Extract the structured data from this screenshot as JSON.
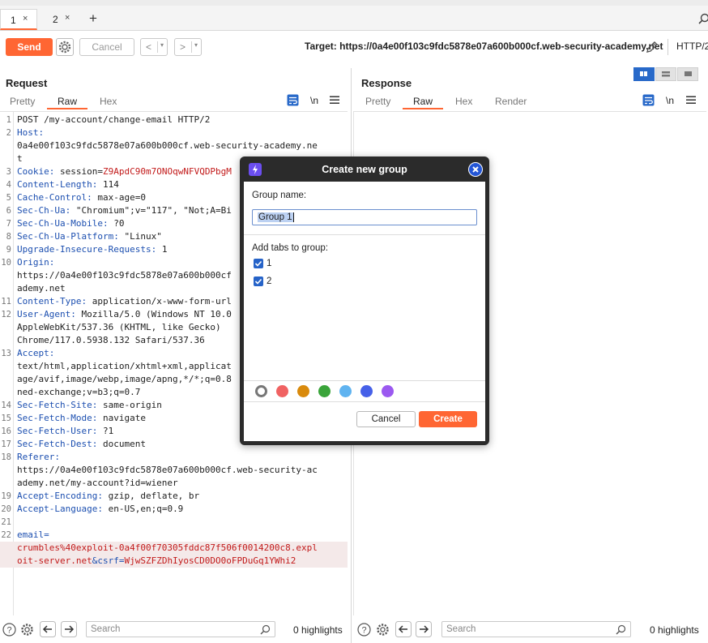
{
  "tabs": [
    {
      "label": "1",
      "close": "×"
    },
    {
      "label": "2",
      "close": "×"
    }
  ],
  "new_tab_icon": "+",
  "toolbar": {
    "send_label": "Send",
    "cancel_label": "Cancel",
    "back_arrow": "<",
    "fwd_arrow": ">",
    "dropdown_caret": "▾",
    "target": "Target: https://0a4e00f103c9fdc5878e07a600b000cf.web-security-academy.net",
    "protocol": "HTTP/2"
  },
  "request": {
    "title": "Request",
    "tabs": [
      "Pretty",
      "Raw",
      "Hex"
    ],
    "active_tab": "Raw",
    "newline_toggle": "\\n",
    "lines": [
      {
        "n": "1",
        "text": "POST /my-account/change-email HTTP/2"
      },
      {
        "n": "2",
        "key": "Host",
        "val": ""
      },
      {
        "n": "",
        "text": "0a4e00f103c9fdc5878e07a600b000cf.web-security-academy.ne"
      },
      {
        "n": "",
        "text": "t"
      },
      {
        "n": "3",
        "key": "Cookie",
        "val": "session=",
        "red": "Z9ApdC90m7ONOqwNFVQDPbgM"
      },
      {
        "n": "4",
        "key": "Content-Length",
        "val": "114"
      },
      {
        "n": "5",
        "key": "Cache-Control",
        "val": "max-age=0"
      },
      {
        "n": "6",
        "key": "Sec-Ch-Ua",
        "val": "\"Chromium\";v=\"117\", \"Not;A=Bi"
      },
      {
        "n": "7",
        "key": "Sec-Ch-Ua-Mobile",
        "val": "?0"
      },
      {
        "n": "8",
        "key": "Sec-Ch-Ua-Platform",
        "val": "\"Linux\""
      },
      {
        "n": "9",
        "key": "Upgrade-Insecure-Requests",
        "val": "1"
      },
      {
        "n": "10",
        "key": "Origin",
        "val": ""
      },
      {
        "n": "",
        "text": "https://0a4e00f103c9fdc5878e07a600b000cf"
      },
      {
        "n": "",
        "text": "ademy.net"
      },
      {
        "n": "11",
        "key": "Content-Type",
        "val": "application/x-www-form-url"
      },
      {
        "n": "12",
        "key": "User-Agent",
        "val": "Mozilla/5.0 (Windows NT 10.0"
      },
      {
        "n": "",
        "text": "AppleWebKit/537.36 (KHTML, like Gecko)"
      },
      {
        "n": "",
        "text": "Chrome/117.0.5938.132 Safari/537.36"
      },
      {
        "n": "13",
        "key": "Accept",
        "val": ""
      },
      {
        "n": "",
        "text": "text/html,application/xhtml+xml,applicat"
      },
      {
        "n": "",
        "text": "age/avif,image/webp,image/apng,*/*;q=0.8"
      },
      {
        "n": "",
        "text": "ned-exchange;v=b3;q=0.7"
      },
      {
        "n": "14",
        "key": "Sec-Fetch-Site",
        "val": "same-origin"
      },
      {
        "n": "15",
        "key": "Sec-Fetch-Mode",
        "val": "navigate"
      },
      {
        "n": "16",
        "key": "Sec-Fetch-User",
        "val": "?1"
      },
      {
        "n": "17",
        "key": "Sec-Fetch-Dest",
        "val": "document"
      },
      {
        "n": "18",
        "key": "Referer",
        "val": ""
      },
      {
        "n": "",
        "text": "https://0a4e00f103c9fdc5878e07a600b000cf.web-security-ac"
      },
      {
        "n": "",
        "text": "ademy.net/my-account?id=wiener"
      },
      {
        "n": "19",
        "key": "Accept-Encoding",
        "val": "gzip, deflate, br"
      },
      {
        "n": "20",
        "key": "Accept-Language",
        "val": "en-US,en;q=0.9"
      },
      {
        "n": "21",
        "text": ""
      },
      {
        "n": "22",
        "body1": "email="
      },
      {
        "n": "",
        "red": "crumbles%40exploit-0a4f00f70305fddc87f506f0014200c8.expl",
        "hl": true
      },
      {
        "n": "",
        "red": "oit-server.net",
        "mid": "&csrf=",
        "red2": "WjwSZFZDhIyosCD0DO0oFPDuGq1YWhi2",
        "hl": true
      }
    ]
  },
  "response": {
    "title": "Response",
    "tabs": [
      "Pretty",
      "Raw",
      "Hex",
      "Render"
    ],
    "active_tab": "Raw",
    "newline_toggle": "\\n"
  },
  "bottom": {
    "search_placeholder": "Search",
    "highlights": "0 highlights"
  },
  "dialog": {
    "title": "Create new group",
    "group_name_label": "Group name:",
    "group_name_value": "Group 1",
    "add_tabs_label": "Add tabs to group:",
    "tab_options": [
      {
        "label": "1",
        "checked": true
      },
      {
        "label": "2",
        "checked": true
      }
    ],
    "colors": [
      "#ffffff",
      "#f06262",
      "#d98a0c",
      "#3aa43a",
      "#5fb3f0",
      "#4660e8",
      "#9b59f0"
    ],
    "selected_color": "#ffffff",
    "cancel_label": "Cancel",
    "create_label": "Create"
  },
  "colors": {
    "accent": "#ff6633",
    "header_key": "#1c4fb0",
    "value_red": "#c21a1a",
    "dialog_bg": "#2b2b2b",
    "checkbox": "#2663c8"
  }
}
